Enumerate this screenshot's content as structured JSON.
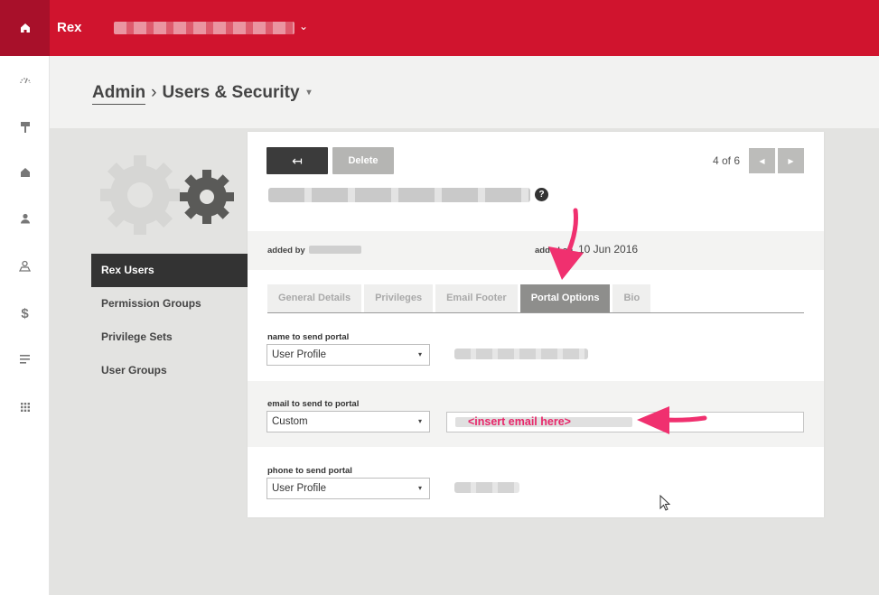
{
  "app": {
    "brand": "Rex"
  },
  "header": {
    "breadcrumb_root": "Admin",
    "separator": "›",
    "breadcrumb_current": "Users & Security",
    "caret": "▾"
  },
  "sidebar": {
    "items": [
      {
        "label": "Rex Users",
        "active": true
      },
      {
        "label": "Permission Groups"
      },
      {
        "label": "Privilege Sets"
      },
      {
        "label": "User Groups"
      }
    ]
  },
  "toolbar": {
    "back_icon": "↤",
    "delete_label": "Delete",
    "pager_text": "4 of 6",
    "prev_icon": "◀",
    "next_icon": "▶",
    "help_icon": "?"
  },
  "meta": {
    "added_by_label": "added by",
    "added_on_label": "added on",
    "added_on_value": "10 Jun 2016"
  },
  "tabs": [
    {
      "label": "General Details"
    },
    {
      "label": "Privileges"
    },
    {
      "label": "Email Footer"
    },
    {
      "label": "Portal Options",
      "active": true
    },
    {
      "label": "Bio"
    }
  ],
  "form": {
    "name": {
      "label": "name to send portal",
      "value": "User Profile"
    },
    "email": {
      "label": "email to send to portal",
      "value": "Custom",
      "input_annotation": "<insert email here>"
    },
    "phone": {
      "label": "phone to send portal",
      "value": "User Profile"
    },
    "caret": "▾"
  },
  "colors": {
    "brand_red": "#d0142e",
    "annotation_pink": "#f0306f"
  }
}
